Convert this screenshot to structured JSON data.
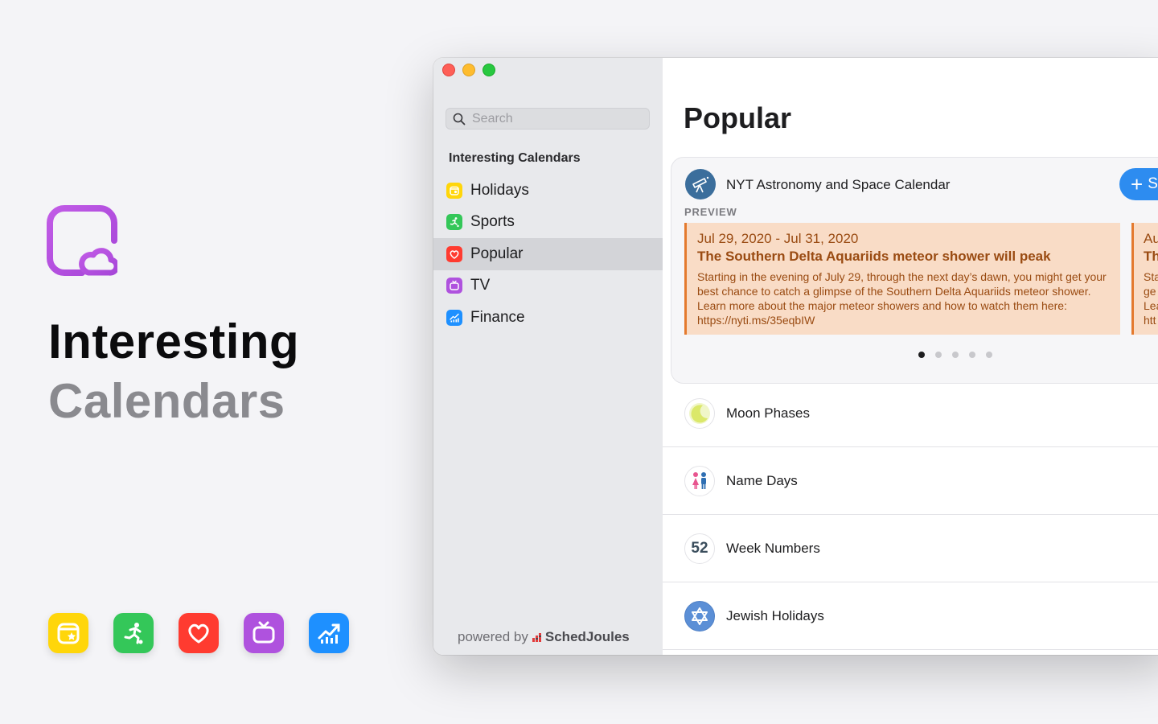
{
  "hero": {
    "title_line1": "Interesting",
    "title_line2": "Calendars"
  },
  "app_icons": [
    {
      "name": "holidays-app-icon",
      "color": "#ffd60a"
    },
    {
      "name": "sports-app-icon",
      "color": "#34c759"
    },
    {
      "name": "popular-app-icon",
      "color": "#ff3b30"
    },
    {
      "name": "tv-app-icon",
      "color": "#af52de"
    },
    {
      "name": "finance-app-icon",
      "color": "#1e90ff"
    }
  ],
  "sidebar": {
    "search_placeholder": "Search",
    "section_title": "Interesting Calendars",
    "items": [
      {
        "label": "Holidays",
        "icon": "holidays-icon",
        "color": "#ffd60a"
      },
      {
        "label": "Sports",
        "icon": "sports-icon",
        "color": "#34c759"
      },
      {
        "label": "Popular",
        "icon": "heart-icon",
        "color": "#ff3b30",
        "selected": true
      },
      {
        "label": "TV",
        "icon": "tv-icon",
        "color": "#af52de"
      },
      {
        "label": "Finance",
        "icon": "chart-icon",
        "color": "#1e90ff"
      }
    ],
    "powered_by": "powered by",
    "brand": "SchedJoules"
  },
  "main": {
    "title": "Popular",
    "featured": {
      "name": "NYT Astronomy and Space Calendar",
      "subscribe_label": "S",
      "preview_label": "PREVIEW",
      "event": {
        "date": "Jul 29, 2020 - Jul 31, 2020",
        "title": "The Southern Delta Aquariids meteor shower will peak",
        "description": "Starting in the evening of July 29, through the next day’s dawn, you might get your best chance to catch a glimpse of the Southern Delta Aquariids meteor shower. Learn more about the major meteor showers and how to watch them here: https://nyti.ms/35eqbIW"
      },
      "next_event": {
        "line1": "Au",
        "line2": "Th",
        "line3": "Sta",
        "line4": "ge",
        "line5": "Lea",
        "line6": "htt"
      },
      "page_count": 5,
      "active_page": 1
    },
    "calendars": [
      {
        "name": "Moon Phases",
        "icon": "moon-icon"
      },
      {
        "name": "Name Days",
        "icon": "people-icon"
      },
      {
        "name": "Week Numbers",
        "icon": "week-number-icon",
        "badge": "52"
      },
      {
        "name": "Jewish Holidays",
        "icon": "star-of-david-icon"
      }
    ]
  }
}
